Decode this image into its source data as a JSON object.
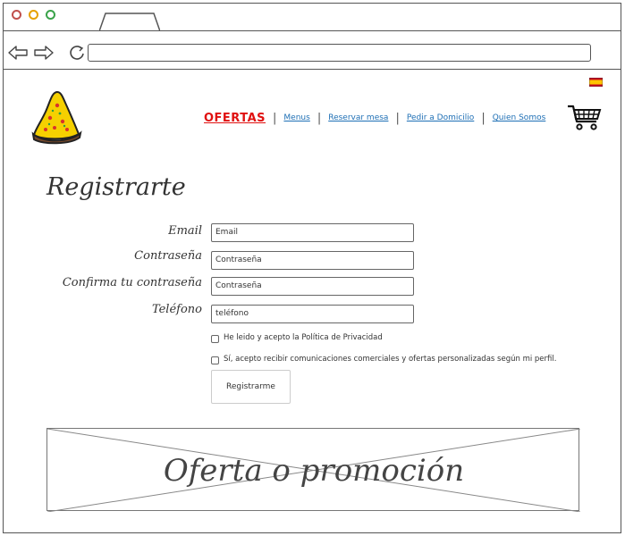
{
  "browser": {
    "window_controls": [
      "close-button",
      "minimize-button",
      "maximize-button"
    ],
    "colors": {
      "close": "#c0504d",
      "minimize": "#e6a100",
      "maximize": "#3aa34a"
    },
    "url": ""
  },
  "header": {
    "nav": {
      "offers": "OFERTAS",
      "menus": "Menus",
      "reservar": "Reservar mesa",
      "pedir": "Pedir a Domicilio",
      "quien": "Quien Somos"
    },
    "offer_color": "#e01010",
    "link_color": "#1e6fb5"
  },
  "form": {
    "title": "Registrarte",
    "fields": {
      "email_label": "Email",
      "email_placeholder": "Email",
      "password_label": "Contraseña",
      "password_placeholder": "Contraseña",
      "confirm_label": "Confirma tu contraseña",
      "confirm_placeholder": "Contraseña",
      "phone_label": "Teléfono",
      "phone_placeholder": "teléfono"
    },
    "privacy": "He leido y acepto la Política de Privacidad",
    "marketing": "Sí, acepto recibir comunicaciones comerciales y ofertas personalizadas según mi perfil.",
    "submit": "Registrarme"
  },
  "promo": {
    "text": "Oferta o promoción"
  }
}
